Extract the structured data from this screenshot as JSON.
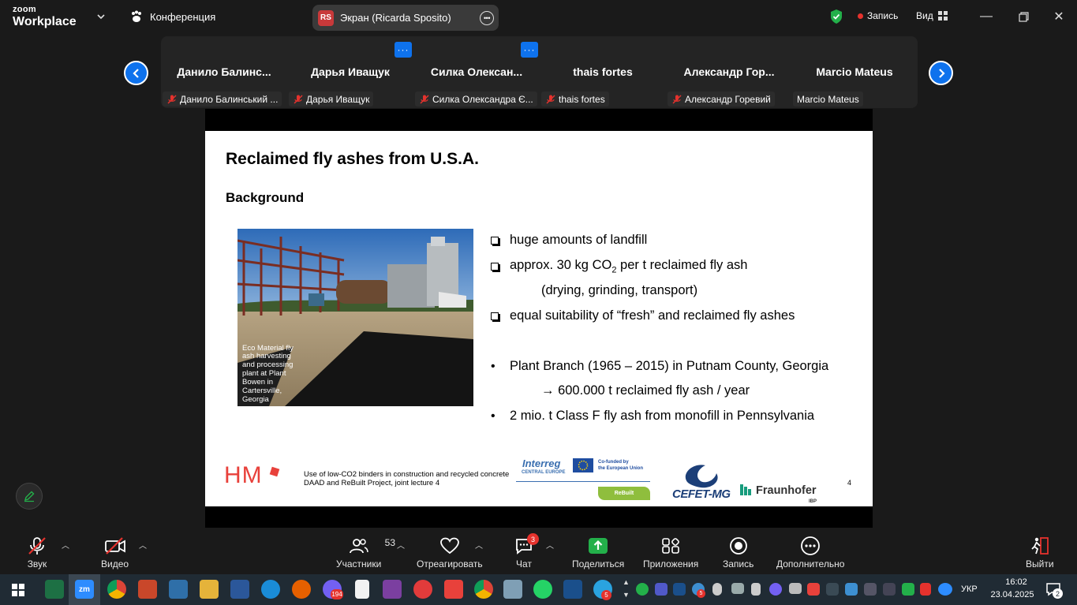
{
  "topbar": {
    "brand_line1": "zoom",
    "brand_line2": "Workplace",
    "conference_label": "Конференция",
    "screen_share_initials": "RS",
    "screen_share_label": "Экран (Ricarda Sposito)",
    "record_label": "Запись",
    "view_label": "Вид",
    "record_dot_color": "#e5322d",
    "shield_color": "#23b04a"
  },
  "participants": [
    {
      "name": "Данило  Балинс...",
      "label": "Данило Балинський ...",
      "muted": true
    },
    {
      "name": "Дарья Иващук",
      "label": "Дарья Иващук",
      "muted": true
    },
    {
      "name": "Силка  Олексан...",
      "label": "Силка Олександра Є...",
      "muted": true
    },
    {
      "name": "thais fortes",
      "label": "thais fortes",
      "muted": true
    },
    {
      "name": "Александр  Гор...",
      "label": "Александр Горевий",
      "muted": true
    },
    {
      "name": "Marcio Mateus",
      "label": "Marcio Mateus",
      "muted": false
    }
  ],
  "slide": {
    "title": "Reclaimed fly ashes from U.S.A.",
    "subtitle": "Background",
    "photo_caption": "Eco Material fly ash harvesting and processing plant at Plant Bowen in Cartersville, Georgia",
    "bullet1": "huge amounts of landfill",
    "bullet2_a": "approx. 30 kg CO",
    "bullet2_sub": "2",
    "bullet2_b": " per t reclaimed fly ash",
    "bullet2_indent": "(drying, grinding, transport)",
    "bullet3": "equal suitability of “fresh” and reclaimed fly ashes",
    "bullet4": "Plant Branch (1965 – 2015) in Putnam County, Georgia",
    "bullet4_indent": "→ 600.000 t reclaimed fly ash / year",
    "bullet5": "2 mio. t Class F fly ash from monofill in Pennsylvania",
    "footer_logo": "HM",
    "footer_line1": "Use of low-CO2 binders in construction and recycled concrete",
    "footer_line2": "DAAD and ReBuilt Project, joint lecture 4",
    "interreg": "Interreg",
    "interreg_sub": "CENTRAL EUROPE",
    "eu_text1": "Co-funded by",
    "eu_text2": "the European Union",
    "rebuilt": "ReBuilt",
    "cefet": "CEFET-MG",
    "fraunhofer": "Fraunhofer",
    "fraunhofer_ibp": "IBP",
    "page_number": "4"
  },
  "toolbar": {
    "audio": "Звук",
    "video": "Видео",
    "participants": "Участники",
    "participants_count": "53",
    "react": "Отреагировать",
    "chat": "Чат",
    "chat_badge": "3",
    "share": "Поделиться",
    "apps": "Приложения",
    "record": "Запись",
    "more": "Дополнительно",
    "leave": "Выйти",
    "share_color": "#23b04a"
  },
  "taskbar": {
    "viber_badge": "194",
    "photo_badge": "5",
    "telegram_badge": "5",
    "language": "УКР",
    "time": "16:02",
    "date": "23.04.2025",
    "notifications": "2"
  }
}
